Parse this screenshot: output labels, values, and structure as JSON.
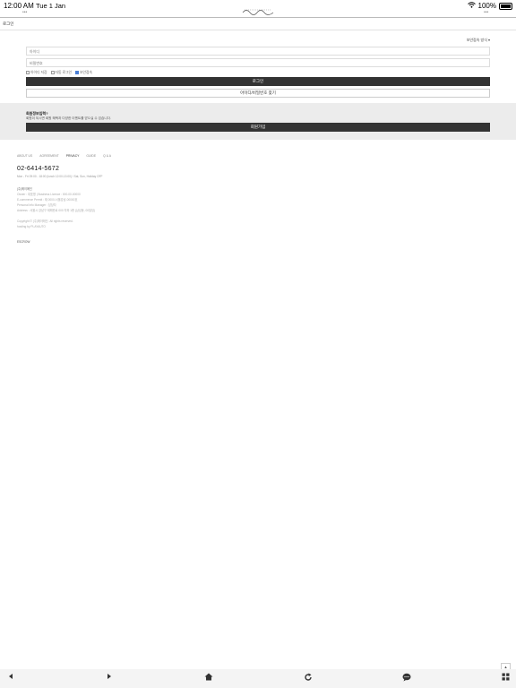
{
  "status_bar": {
    "time": "12:00 AM",
    "date": "Tue 1 Jan",
    "battery": "100%"
  },
  "breadcrumb": "로그인",
  "login": {
    "security_select": "보안접속 방식 ▾",
    "id_placeholder": "아이디",
    "password_placeholder": "비밀번호",
    "checks": [
      "아이디 저장",
      "자동 로그인",
      "보안접속"
    ],
    "login_button": "로그인",
    "find_button": "아이디/비밀번호 찾기"
  },
  "join": {
    "title": "회원정보입력?",
    "desc": "회원이 되시면 회원 혜택과 다양한 이벤트를 받으실 수 있습니다.",
    "button": "회원가입"
  },
  "footer": {
    "links": [
      "ABOUT US",
      "AGREEMENT",
      "PRIVACY",
      "GUIDE",
      "Q & A"
    ],
    "phone": "02-6414-5672",
    "hours": "Mon - Fri 09:00 - 18:00 (lunch 12:00-13:00) / Sat, Sun, Holiday OFF",
    "company": "(주)에이메딘",
    "owner_line": "Owner : 대표명 | Business Licence : 000-00-00000",
    "ecommerce_line": "E-commerce Permit : 제 0000-서울강남-00000호",
    "privacy_line": "Personal Info Manager : 담당자",
    "address_line": "Address : 서울시 강남구 테헤란로 000 지하 1층 (삼성동, 00빌딩)",
    "copyright": "Copyright © (주)에이메딘. All rights reserved.",
    "hosting": "hosting by PLAYAUTO",
    "escrow": "ESCROW"
  },
  "toolbar": {
    "icons": [
      "back-icon",
      "forward-icon",
      "home-icon",
      "refresh-icon",
      "chat-icon",
      "grid-icon"
    ]
  }
}
